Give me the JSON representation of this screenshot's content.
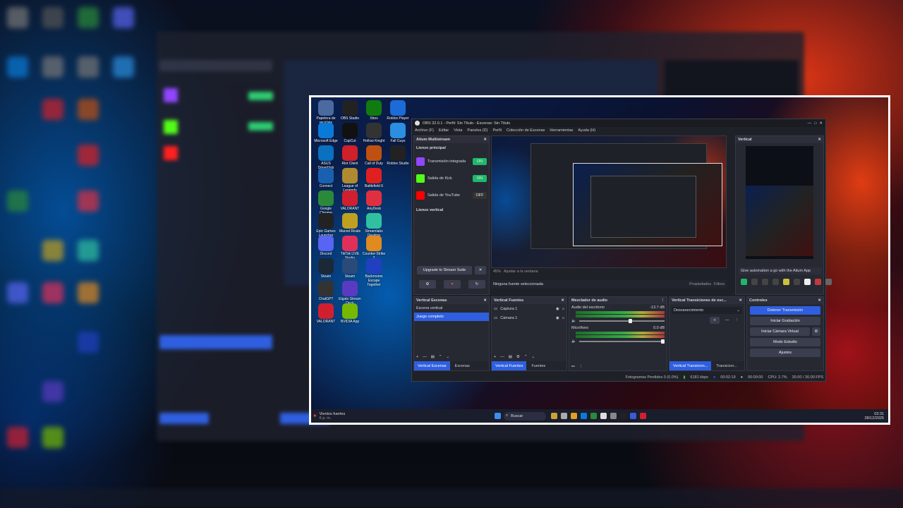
{
  "desktop_icons": [
    {
      "label": "Papelera de reciclaje",
      "color": "#4a6aa0"
    },
    {
      "label": "OBS Studio",
      "color": "#222"
    },
    {
      "label": "Xbox",
      "color": "#107c10"
    },
    {
      "label": "Roblox Player",
      "color": "#1d6bd8"
    },
    {
      "label": "Microsoft Edge",
      "color": "#0a7ad8"
    },
    {
      "label": "CapCut",
      "color": "#111"
    },
    {
      "label": "Hollow Knight",
      "color": "#333"
    },
    {
      "label": "Fall Guys",
      "color": "#2b8ee0"
    },
    {
      "label": "ASUS DriverHub",
      "color": "#0a70c0"
    },
    {
      "label": "Riot Client",
      "color": "#d0202a"
    },
    {
      "label": "Call of Duty",
      "color": "#c05010"
    },
    {
      "label": "Roblox Studio",
      "color": "#222"
    },
    {
      "label": "Connect",
      "color": "#1a60b0"
    },
    {
      "label": "League of Legends",
      "color": "#b08a30"
    },
    {
      "label": "Battlefield 6",
      "color": "#e02020"
    },
    {
      "label": "",
      "color": "#555"
    },
    {
      "label": "Google Chrome",
      "color": "#2a8a3a"
    },
    {
      "label": "VALORANT",
      "color": "#d02030"
    },
    {
      "label": "AnyDesk",
      "color": "#e03040"
    },
    {
      "label": "",
      "color": "#555"
    },
    {
      "label": "Epic Games Launcher",
      "color": "#222"
    },
    {
      "label": "Marvel Rivals",
      "color": "#c0a020"
    },
    {
      "label": "Streamlabs Desktop",
      "color": "#30c0a0"
    },
    {
      "label": "",
      "color": "#555"
    },
    {
      "label": "Discord",
      "color": "#5865f2"
    },
    {
      "label": "TikTok LIVE Studio",
      "color": "#e0305a"
    },
    {
      "label": "Counter-Strike 2",
      "color": "#e08a20"
    },
    {
      "label": "",
      "color": "#555"
    },
    {
      "label": "Steam",
      "color": "#1b2838"
    },
    {
      "label": "Steam",
      "color": "#2a4a7a"
    },
    {
      "label": "Backrooms Escape Together",
      "color": "#2040c0"
    },
    {
      "label": "",
      "color": "#555"
    },
    {
      "label": "ChatGPT",
      "color": "#333"
    },
    {
      "label": "Elgato Stream Deck",
      "color": "#5a3ac0"
    },
    {
      "label": "",
      "color": "#555"
    },
    {
      "label": "",
      "color": "#555"
    },
    {
      "label": "VALORANT",
      "color": "#d02030"
    },
    {
      "label": "NVIDIA App",
      "color": "#76b900"
    }
  ],
  "obs": {
    "title": "OBS 32.0.1 - Perfil: Sin Título - Escenas: Sin Título",
    "menu": [
      "Archivo (F)",
      "Editar",
      "Vista",
      "Paneles (D)",
      "Perfil",
      "Colección de Escenas",
      "Herramientas",
      "Ayuda (H)"
    ],
    "multistream": {
      "title": "Aitum Multistream",
      "main_canvas": "Lienzo principal",
      "outputs": [
        {
          "label": "Transmisión integrada",
          "color": "#9146ff"
        },
        {
          "label": "Salida de Kick",
          "color": "#53fc18"
        },
        {
          "label": "Salida de YouTube",
          "color": "#ff0000"
        }
      ],
      "vertical_canvas": "Lienzo vertical",
      "upgrade": "Upgrade to Stream Suite"
    },
    "preview": {
      "zoom": "45%",
      "fit": "Ajustar a la ventana",
      "no_source": "Ninguna fuente seleccionada",
      "properties": "Propiedades",
      "filters": "Filtros"
    },
    "vertical": {
      "title": "Vertical",
      "automation": "Give automation a go with the Aitum App"
    },
    "scenes": {
      "title": "Vertical Escenas",
      "items": [
        "Escena vertical",
        "Juego completo"
      ],
      "tabs": [
        "Vertical Escenas",
        "Escenas"
      ]
    },
    "sources": {
      "title": "Vertical Fuentes",
      "items": [
        "Captura 1",
        "Cámara 1"
      ],
      "tabs": [
        "Vertical Fuentes",
        "Fuentes"
      ]
    },
    "mixer": {
      "title": "Mezclador de audio",
      "channels": [
        {
          "name": "Audio del escritorio",
          "db": "-13.7 dB"
        },
        {
          "name": "Micrófono",
          "db": "0.0 dB"
        }
      ]
    },
    "transitions": {
      "title": "Vertical Transiciones de esc...",
      "type": "Desvanecimiento",
      "tabs": [
        "Vertical Transicion...",
        "Transicion..."
      ]
    },
    "controls": {
      "title": "Controles",
      "buttons": [
        "Detener Transmisión",
        "Iniciar Grabación",
        "Iniciar Cámara Virtual",
        "Modo Estudio",
        "Ajustes"
      ]
    },
    "status": {
      "dropped": "Fotogramas Perdidos 0 (0.0%)",
      "bitrate": "6181 kbps",
      "stream_time": "00:02:19",
      "rec_time": "00:00:00",
      "cpu": "CPU: 2.7%",
      "fps": "30.00 / 30.00 FPS"
    }
  },
  "taskbar": {
    "weather": "Vientos fuertes",
    "weather_sub": "6 p. m.",
    "search": "Buscar",
    "time": "03:31",
    "date": "28/12/2025"
  }
}
